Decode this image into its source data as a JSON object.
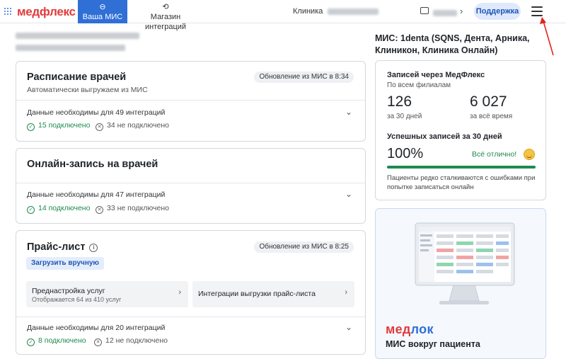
{
  "header": {
    "logo": "медфлекс",
    "tabs": [
      {
        "label": "Ваша МИС",
        "active": true
      },
      {
        "label": "Магазин интеграций",
        "active": false
      }
    ],
    "clinic_label": "Клиника",
    "support_label": "Поддержка"
  },
  "schedule": {
    "title": "Расписание врачей",
    "subtitle": "Автоматически выгружаем из МИС",
    "badge": "Обновление из МИС в 8:34",
    "needed": "Данные необходимы для 49 интеграций",
    "connected": "15 подключено",
    "not_connected": "34 не подключено"
  },
  "online": {
    "title": "Онлайн-запись на врачей",
    "needed": "Данные необходимы для 47 интеграций",
    "connected": "14 подключено",
    "not_connected": "33 не подключено"
  },
  "pricelist": {
    "title": "Прайс-лист",
    "badge": "Обновление из МИС в 8:25",
    "upload_label": "Загрузить вручную",
    "tile_services_title": "Преднастройка услуг",
    "tile_services_sub": "Отображается 64 из 410 услуг",
    "tile_export_title": "Интеграции выгрузки прайс-листа",
    "needed": "Данные необходимы для 20 интеграций",
    "connected": "8 подключено",
    "not_connected": "12 не подключено"
  },
  "mis": {
    "title": "МИС: 1denta (SQNS, Дента, Арника, Клиникон, Клиника Онлайн)"
  },
  "stats": {
    "title": "Записей через МедФлекс",
    "subtitle": "По всем филиалам",
    "count_30": "126",
    "count_30_label": "за 30 дней",
    "count_all": "6 027",
    "count_all_label": "за всё время",
    "success_title": "Успешных записей за 30 дней",
    "success_pct": "100%",
    "success_status": "Всё отлично!",
    "success_fraction": 1.0,
    "note": "Пациенты редко сталкиваются с ошибками при попытке записаться онлайн"
  },
  "promo": {
    "logo_part1": "мед",
    "logo_part2": "лок",
    "tagline": "МИС вокруг пациента"
  },
  "colors": {
    "brand_red": "#e23a3a",
    "accent_blue": "#2f6fd6",
    "success_green": "#1d8a4f"
  }
}
